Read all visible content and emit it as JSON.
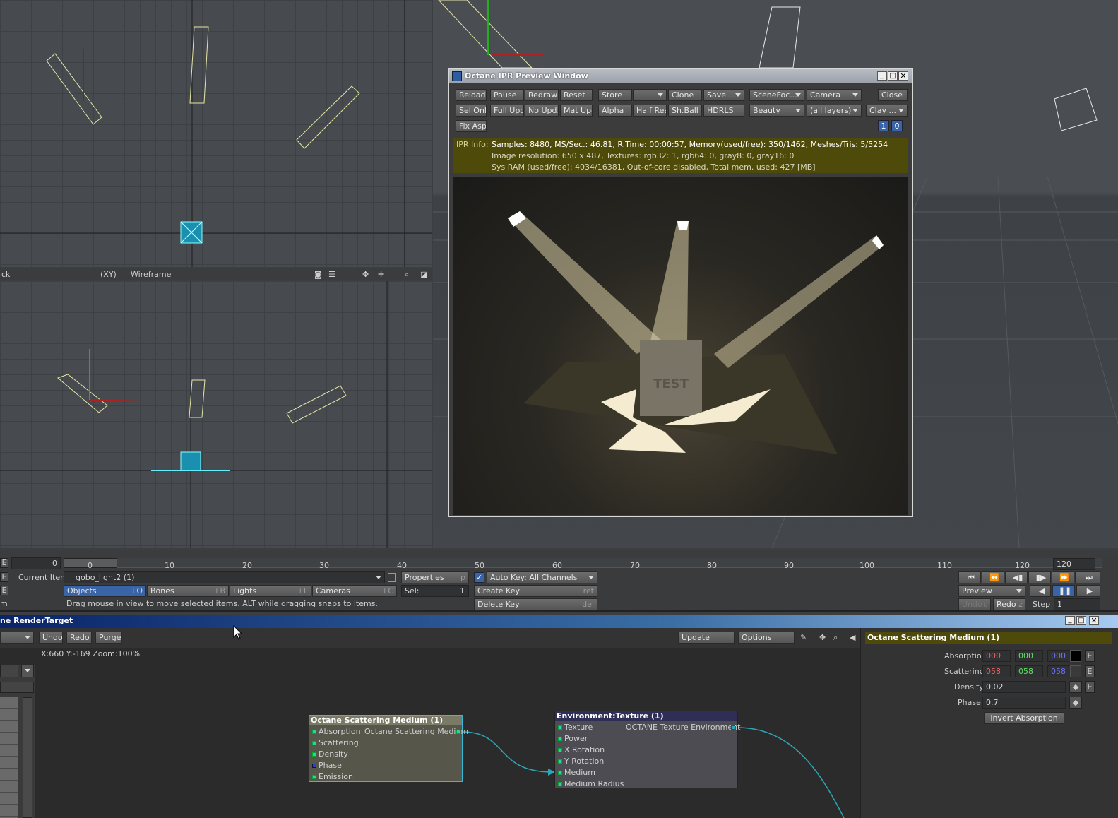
{
  "viewport_top_left": {},
  "viewport_bar": {
    "left_label": "ck",
    "view_mode": "(XY)",
    "render_mode": "Wireframe"
  },
  "ipr": {
    "title": "Octane IPR Preview Window",
    "row1": [
      "Reload",
      "Pause",
      "Redraw",
      "Reset",
      "Store",
      "",
      "Clone",
      "Save ...",
      "SceneFoc...",
      "Camera",
      "Close"
    ],
    "row2": [
      "Sel Only",
      "Full Upd.",
      "No Upd.",
      "Mat Upd",
      "Alpha",
      "Half Res",
      "Sh.Ball",
      "HDRLS",
      "Beauty",
      "(all layers)",
      "Clay ..."
    ],
    "row3": [
      "Fix Asp."
    ],
    "counters": [
      "1",
      "0"
    ],
    "info_label": "IPR Info:",
    "info_lines": [
      "Samples: 8480, MS/Sec.: 46.81, R.Time: 00:00:57, Memory(used/free): 350/1462, Meshes/Tris: 5/5254",
      "Image resolution: 650 x 487, Textures:  rgb32: 1, rgb64: 0, gray8: 0, gray16: 0",
      "Sys RAM (used/free): 4034/16381, Out-of-core disabled, Total mem. used: 427  [MB]"
    ],
    "render_text": "TEST"
  },
  "timeline": {
    "start_value": "0",
    "ticks": [
      "0",
      "10",
      "20",
      "30",
      "40",
      "50",
      "60",
      "70",
      "80",
      "90",
      "100",
      "110",
      "120",
      "120"
    ]
  },
  "controls": {
    "e_labels": [
      "E",
      "E",
      "m"
    ],
    "current_item_label": "Current Item",
    "current_item": "gobo_light2 (1)",
    "properties": "Properties",
    "properties_key": "p",
    "auto_key": "Auto Key: All Channels",
    "tabs": [
      {
        "label": "Objects",
        "key": "+O"
      },
      {
        "label": "Bones",
        "key": "+B"
      },
      {
        "label": "Lights",
        "key": "+L"
      },
      {
        "label": "Cameras",
        "key": "+C"
      }
    ],
    "sel_label": "Sel:",
    "sel_value": "1",
    "create_key": "Create Key",
    "create_key_hot": "ret",
    "delete_key": "Delete Key",
    "delete_key_hot": "del",
    "status": "Drag mouse in view to move selected items. ALT while dragging snaps to items.",
    "preview": "Preview",
    "undo": "Undo",
    "undo_key": "u",
    "redo": "Redo",
    "redo_key": "z",
    "step_label": "Step",
    "step_value": "1"
  },
  "node_editor": {
    "title": "ne RenderTarget",
    "undo": "Undo",
    "redo": "Redo",
    "purge": "Purge",
    "update": "Update",
    "options": "Options",
    "coords": "X:660 Y:-169 Zoom:100%",
    "selected_title": "Octane Scattering Medium (1)",
    "props": [
      {
        "label": "Absorption",
        "r": "000",
        "g": "000",
        "b": "000"
      },
      {
        "label": "Scattering",
        "r": "058",
        "g": "058",
        "b": "058"
      }
    ],
    "density_label": "Density",
    "density": "0.02",
    "phase_label": "Phase",
    "phase": "0.7",
    "invert": "Invert Absorption",
    "e_btn": "E",
    "node1": {
      "title": "Octane Scattering Medium (1)",
      "output": "Octane Scattering Medium",
      "inputs": [
        "Absorption",
        "Scattering",
        "Density",
        "Phase",
        "Emission"
      ]
    },
    "node2": {
      "title": "Environment:Texture (1)",
      "output": "OCTANE Texture Environment",
      "inputs": [
        "Texture",
        "Power",
        "X Rotation",
        "Y Rotation",
        "Medium",
        "Medium Radius"
      ]
    }
  },
  "colors": {
    "accent": "#3a64a8",
    "info_bg": "#4e4a0a",
    "node_port": "#2cd2a3",
    "wire": "#2aa8b8"
  }
}
